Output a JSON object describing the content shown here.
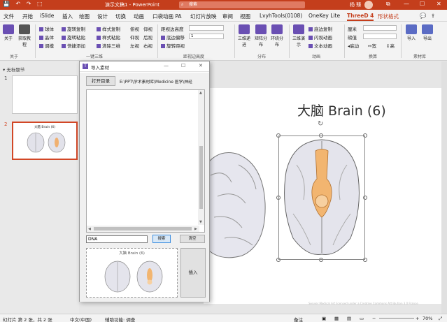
{
  "app": {
    "title": "演示文稿1 - PowerPoint",
    "search_placeholder": "搜索",
    "user": "杨 臻",
    "window_controls": [
      "restore-icon",
      "minimize-icon",
      "maximize-icon",
      "close-icon"
    ]
  },
  "menu": [
    "文件",
    "开始",
    "iSlide",
    "插入",
    "绘图",
    "设计",
    "切换",
    "动画",
    "口袋动画 PA",
    "幻灯片放映",
    "审阅",
    "视图",
    "LvyhTools(0108)",
    "OneKey Lite",
    "ThreeD 4",
    "形状格式"
  ],
  "menu_active": "ThreeD 4",
  "ribbon": {
    "about_btn": "关于",
    "get_tutorial": "获取教程",
    "group1_label": "关于",
    "col1": [
      "球体",
      "晶体",
      "调模"
    ],
    "col2": [
      "旋转复制",
      "旋转粘贴",
      "快捷添加"
    ],
    "col3": [
      "样式复制",
      "样式粘贴",
      "清除三维"
    ],
    "col4": [
      "俯视",
      "仰视",
      "左视"
    ],
    "col5": [
      "仰视",
      "后视",
      "右视"
    ],
    "group2_label": "一键三维",
    "pos_high": "距视边高度",
    "pos_high_val": "",
    "offset": "底边偏移",
    "offset_val": "1",
    "rotate_btn": "旋转距视",
    "group3_label": "距视边高度",
    "big3d": [
      "三维递进",
      "矩阵分布",
      "环绕分布"
    ],
    "group4_label": "分布",
    "demo": "三维演示",
    "anim": [
      "底边复制",
      "闪视动画",
      "文本动画"
    ],
    "group5_label": "动画",
    "unit1": "厘米",
    "unit2": "磅值",
    "bottom_side": "底边",
    "width": "宽",
    "height": "高",
    "group6_label": "换算",
    "import": "导入",
    "export": "导出",
    "group7_label": "素材库"
  },
  "sidebar": {
    "section": "无标题节",
    "slide1": "1",
    "slide2": "2",
    "thumb2_title": "大脑 Brain (6)"
  },
  "slide": {
    "title": "大脑 Brain (6)",
    "credit": "Servier Medical Art licensed under a Creative Commons Attribution 3.0 France"
  },
  "dialog": {
    "title": "导入素材",
    "open_dir": "打开目录",
    "path": "E:\\PPT\\学术素材库\\Medicine 医学\\神经",
    "search_value": "DNA",
    "search_btn": "搜索",
    "clear_btn": "清空",
    "preview_title": "大脑 Brain (6)",
    "insert_btn": "插入"
  },
  "status": {
    "slides": "幻灯片 第 2 张，共 2 张",
    "lang": "中文(中国)",
    "access": "辅助功能: 调查",
    "notes": "备注",
    "zoom": "70%"
  }
}
